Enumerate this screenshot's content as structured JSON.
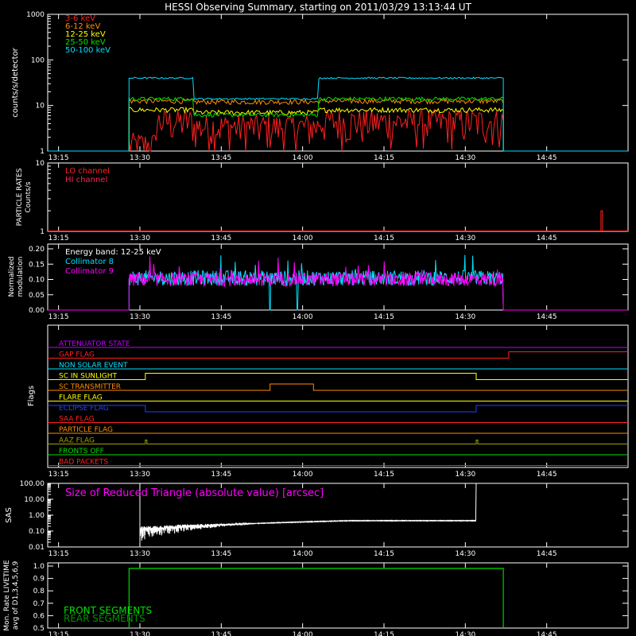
{
  "title": "HESSI Observing Summary, starting on 2011/03/29 13:13:44 UT",
  "x_tick_labels": [
    "13:15",
    "13:30",
    "13:45",
    "14:00",
    "14:15",
    "14:30",
    "14:45"
  ],
  "colors": {
    "red": "#ff2020",
    "orange": "#ff8c00",
    "yellow": "#ffff00",
    "green": "#00e000",
    "cyan": "#00e0ff",
    "magenta": "#ff00ff",
    "white": "#ffffff",
    "blue": "#2040ff",
    "olive": "#a0a000",
    "crimson": "#ff2050",
    "purple": "#c000ff"
  },
  "chart_data": [
    {
      "type": "line",
      "ylabel": "counts/s/detector",
      "yscale": "log",
      "ylim": [
        1,
        1000
      ],
      "y_tick_labels": [
        "1",
        "10",
        "100",
        "1000"
      ],
      "xlim": [
        "13:13",
        "15:00"
      ],
      "series": [
        {
          "name": "3-6 keV",
          "color": "#ff2020",
          "x": [
            "13:28",
            "13:40",
            "13:42",
            "14:00",
            "14:20",
            "14:37"
          ],
          "y": [
            1.5,
            3,
            3.5,
            4.5,
            4,
            4
          ]
        },
        {
          "name": "6-12 keV",
          "color": "#ff8c00",
          "x": [
            "13:28",
            "13:40",
            "13:42",
            "14:00",
            "14:20",
            "14:37"
          ],
          "y": [
            12,
            13,
            12,
            12,
            12,
            12
          ]
        },
        {
          "name": "12-25 keV",
          "color": "#ffff00",
          "x": [
            "13:28",
            "13:40",
            "13:42",
            "14:00",
            "14:20",
            "14:37"
          ],
          "y": [
            7,
            8,
            7,
            7,
            7,
            7
          ]
        },
        {
          "name": "25-50 keV",
          "color": "#00e000",
          "x": [
            "13:28",
            "13:40",
            "13:42",
            "14:00",
            "14:20",
            "14:37"
          ],
          "y": [
            14,
            14,
            6,
            6,
            14,
            14
          ]
        },
        {
          "name": "50-100 keV",
          "color": "#00e0ff",
          "x": [
            "13:28",
            "13:40",
            "13:42",
            "14:00",
            "14:20",
            "14:37"
          ],
          "y": [
            40,
            40,
            14,
            14,
            40,
            38
          ]
        }
      ]
    },
    {
      "type": "line",
      "ylabel": "PARTICLE RATES Counts/s",
      "yscale": "log",
      "ylim": [
        1,
        10
      ],
      "y_tick_labels": [
        "1",
        "10"
      ],
      "series": [
        {
          "name": "LO channel",
          "color": "#ff2020",
          "x": [
            "13:13",
            "14:55",
            "14:56",
            "15:00"
          ],
          "y": [
            1,
            1,
            2,
            1
          ]
        },
        {
          "name": "HI channel",
          "color": "#ff2050",
          "x": [
            "13:13",
            "15:00"
          ],
          "y": [
            1,
            1
          ]
        }
      ]
    },
    {
      "type": "line",
      "ylabel": "Normalized modulation",
      "ylim": [
        0,
        0.2
      ],
      "y_tick_labels": [
        "0.00",
        "0.05",
        "0.10",
        "0.15",
        "0.20"
      ],
      "annotation": "Energy band: 12-25 keV",
      "series": [
        {
          "name": "Collimator 8",
          "color": "#00e0ff",
          "x": [
            "13:28",
            "14:37"
          ],
          "y": [
            0.105,
            0.105
          ]
        },
        {
          "name": "Collimator 9",
          "color": "#ff00ff",
          "x": [
            "13:28",
            "14:37"
          ],
          "y": [
            0.1,
            0.1
          ]
        }
      ]
    },
    {
      "type": "line",
      "ylabel": "Flags",
      "flags": [
        {
          "name": "ATTENUATOR STATE",
          "color": "#c000ff"
        },
        {
          "name": "GAP FLAG",
          "color": "#ff2020"
        },
        {
          "name": "NON SOLAR EVENT",
          "color": "#00e0ff"
        },
        {
          "name": "SC IN SUNLIGHT",
          "color": "#ffff00"
        },
        {
          "name": "SC TRANSMITTER",
          "color": "#ff8c00"
        },
        {
          "name": "FLARE FLAG",
          "color": "#ffff00"
        },
        {
          "name": "ECLIPSE FLAG",
          "color": "#2040ff"
        },
        {
          "name": "SAA FLAG",
          "color": "#ff2020"
        },
        {
          "name": "PARTICLE FLAG",
          "color": "#ff8c00"
        },
        {
          "name": "AAZ FLAG",
          "color": "#a0a000"
        },
        {
          "name": "FRONTS OFF",
          "color": "#00e000"
        },
        {
          "name": "BAD PACKETS",
          "color": "#ff2020"
        }
      ]
    },
    {
      "type": "line",
      "ylabel": "SAS",
      "yscale": "log",
      "ylim": [
        0.01,
        100
      ],
      "y_tick_labels": [
        "0.01",
        "0.10",
        "1.00",
        "10.00",
        "100.00"
      ],
      "annotation": "Size of Reduced Triangle (absolute value) [arcsec]",
      "series": [
        {
          "color": "#ffffff",
          "x": [
            "13:30",
            "13:35",
            "13:45",
            "14:00",
            "14:15",
            "14:32"
          ],
          "y": [
            0.3,
            0.08,
            0.2,
            0.4,
            0.45,
            0.45
          ]
        }
      ]
    },
    {
      "type": "line",
      "ylabel": "Mon. Rate LIVETIME avg of D1,3,4,5,6,9",
      "ylim": [
        0.5,
        1.0
      ],
      "y_tick_labels": [
        "0.5",
        "0.6",
        "0.7",
        "0.8",
        "0.9",
        "1.0"
      ],
      "series": [
        {
          "name": "FRONT SEGMENTS",
          "color": "#00e000",
          "x": [
            "13:28",
            "14:37"
          ],
          "y": [
            0.98,
            0.98
          ]
        },
        {
          "name": "REAR SEGMENTS",
          "color": "#009000",
          "x": [
            "13:28",
            "14:37"
          ],
          "y": [
            0.98,
            0.98
          ]
        }
      ]
    }
  ]
}
